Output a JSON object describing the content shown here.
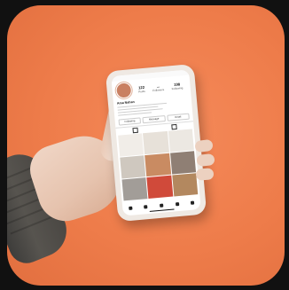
{
  "scene": {
    "background_color": "#111111",
    "tile_color": "#ee7c4a",
    "skin_color": "#f0d6c6",
    "sleeve_color": "#4a4743",
    "phone_body_color": "#efe9e3"
  },
  "profile": {
    "name": "Ama Nahan",
    "stats": [
      {
        "value": "122",
        "label": "Posts"
      },
      {
        "value": "...",
        "label": "Followers"
      },
      {
        "value": "198",
        "label": "Following"
      }
    ],
    "buttons": [
      "Following",
      "Message",
      "Email"
    ],
    "grid_colors": [
      "#f1ede8",
      "#e7e1d9",
      "#ece8e2",
      "#cfc8bf",
      "#c98b62",
      "#8f7f74",
      "#a29d98",
      "#d04a3a",
      "#b3885f"
    ]
  },
  "icons": [
    "home-icon",
    "search-icon",
    "add-icon",
    "reels-icon",
    "profile-icon"
  ]
}
